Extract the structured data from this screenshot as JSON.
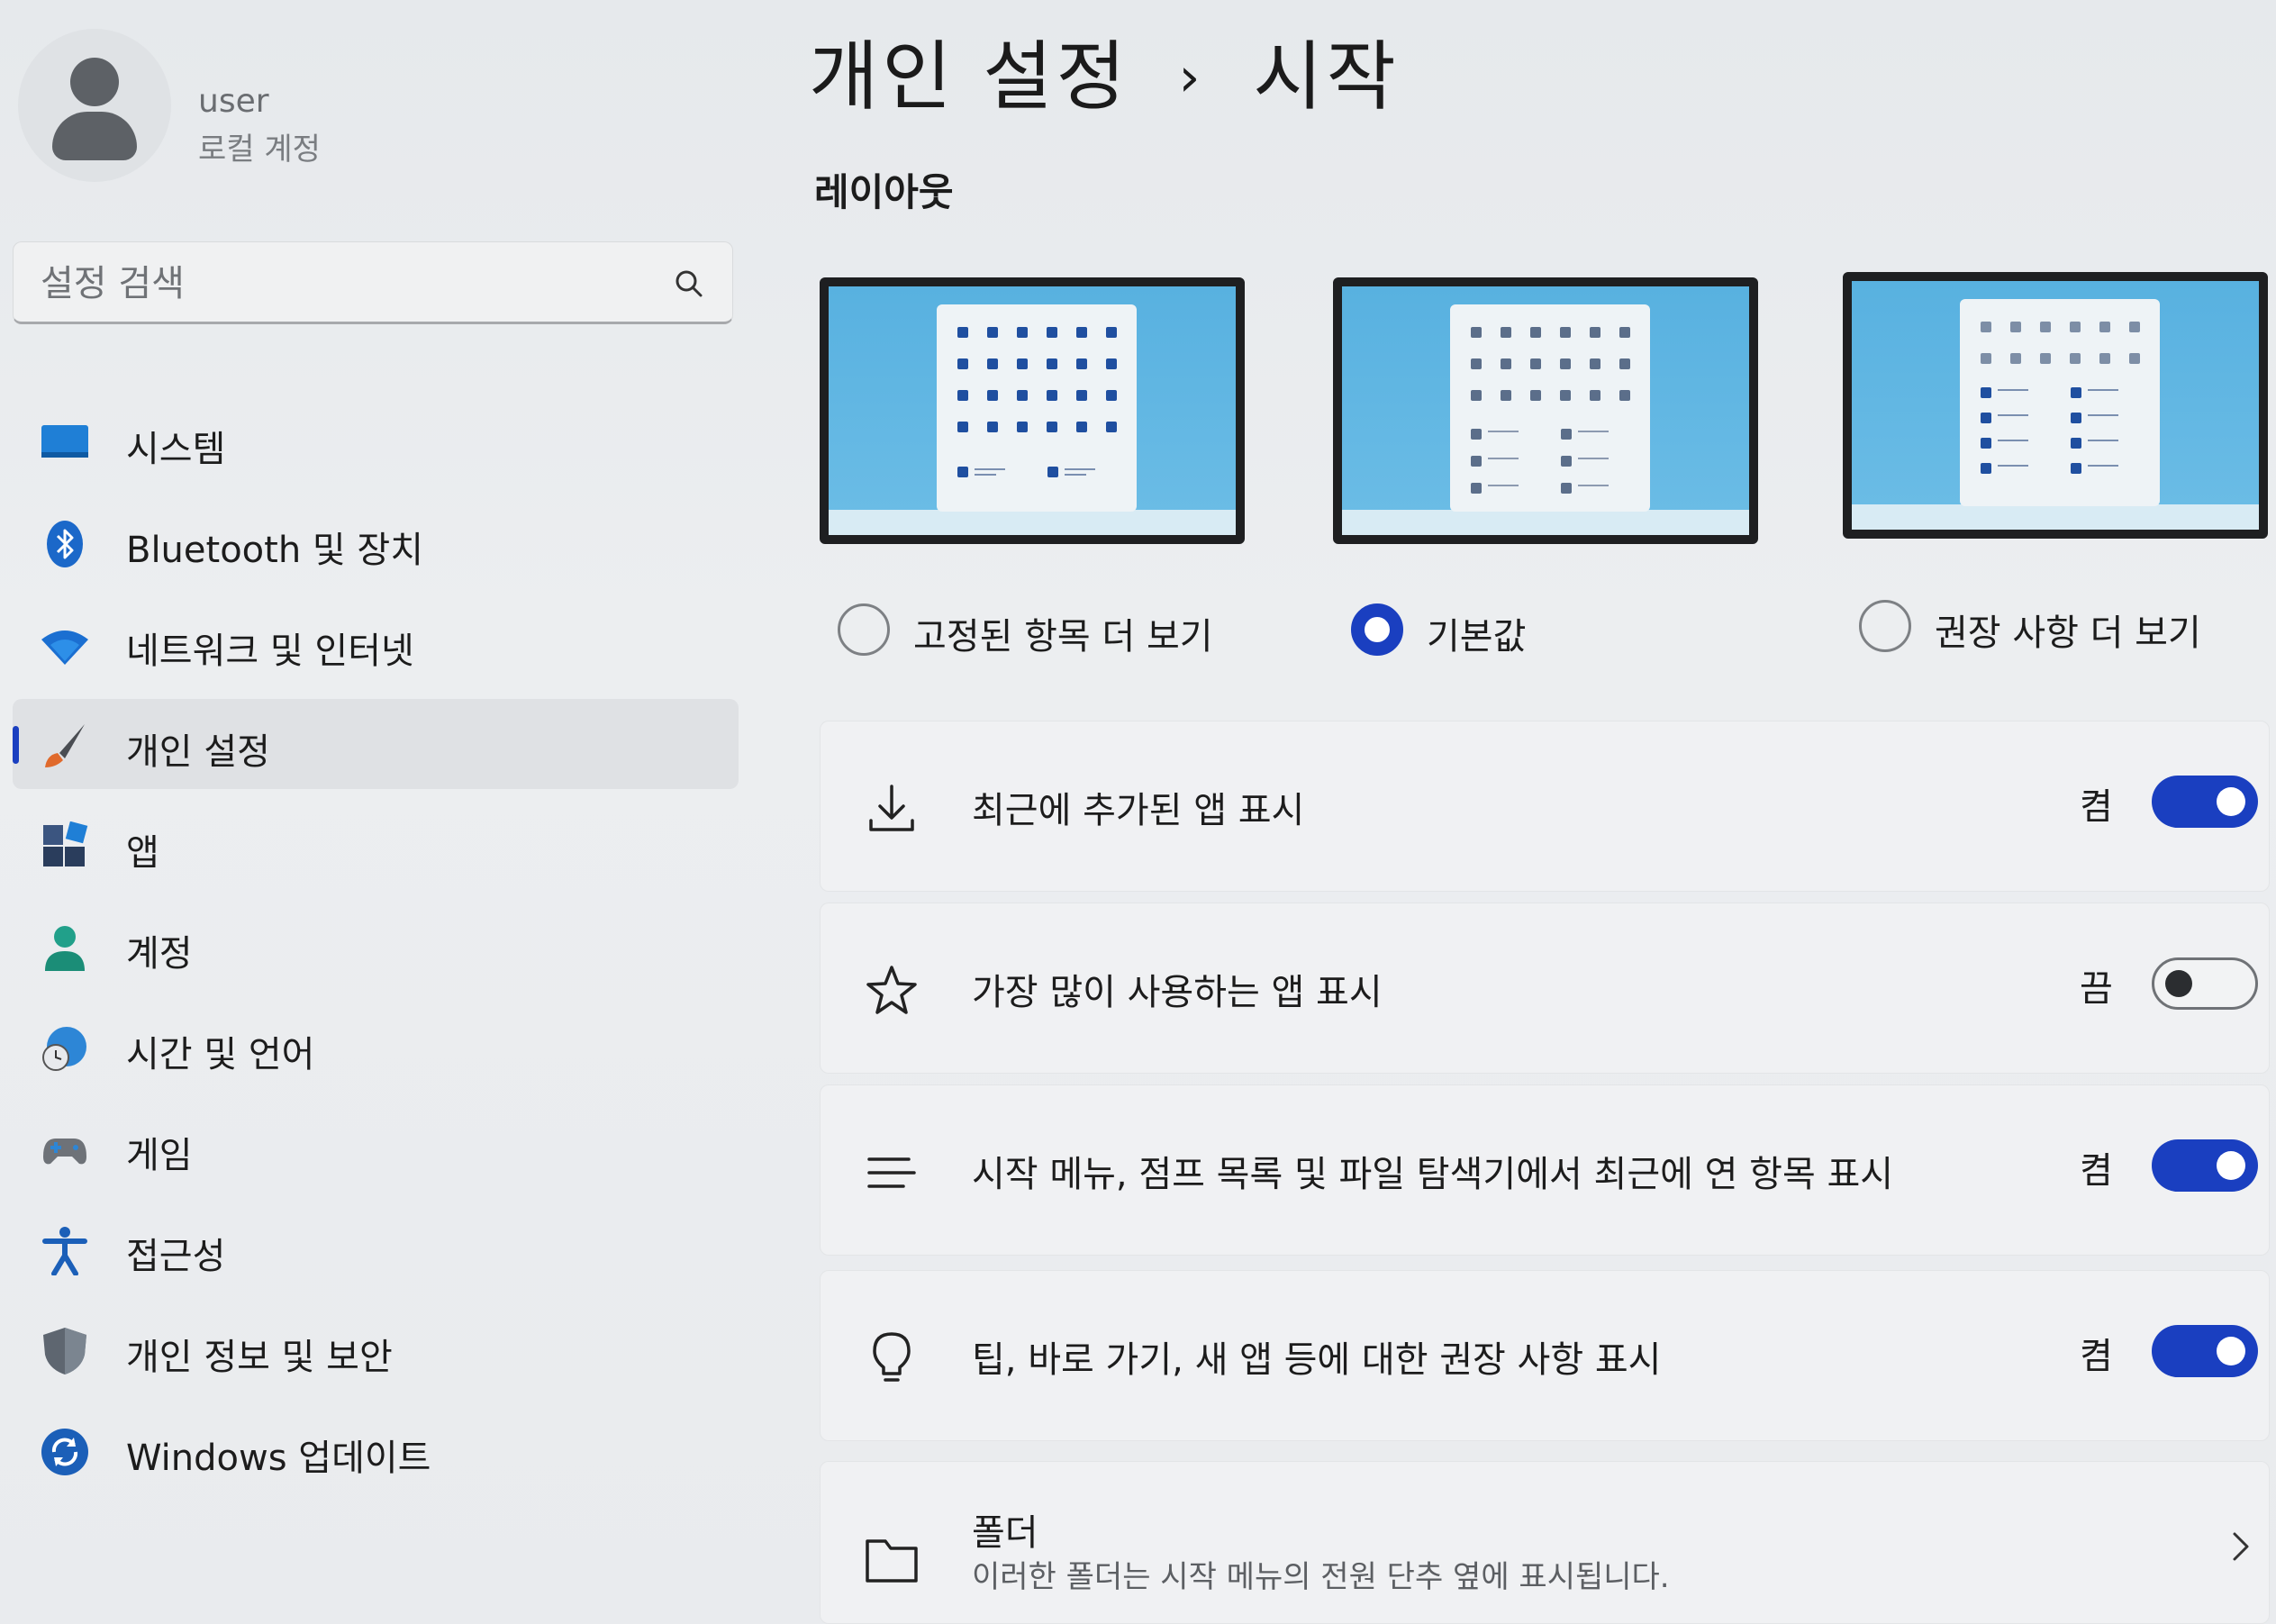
{
  "user": {
    "name": "user",
    "account_type": "로컬 계정"
  },
  "search": {
    "placeholder": "설정 검색"
  },
  "sidebar": {
    "items": [
      {
        "label": "시스템",
        "icon": "system-icon"
      },
      {
        "label": "Bluetooth 및 장치",
        "icon": "bluetooth-icon"
      },
      {
        "label": "네트워크 및 인터넷",
        "icon": "wifi-icon"
      },
      {
        "label": "개인 설정",
        "icon": "brush-icon",
        "selected": true
      },
      {
        "label": "앱",
        "icon": "apps-icon"
      },
      {
        "label": "계정",
        "icon": "account-icon"
      },
      {
        "label": "시간 및 언어",
        "icon": "globe-clock-icon"
      },
      {
        "label": "게임",
        "icon": "gamepad-icon"
      },
      {
        "label": "접근성",
        "icon": "accessibility-icon"
      },
      {
        "label": "개인 정보 및 보안",
        "icon": "shield-icon"
      },
      {
        "label": "Windows 업데이트",
        "icon": "update-icon"
      }
    ]
  },
  "header": {
    "breadcrumb_parent": "개인 설정",
    "separator": "›",
    "current": "시작"
  },
  "layout": {
    "section_title": "레이아웃",
    "options": [
      {
        "label": "고정된 항목 더 보기",
        "checked": false
      },
      {
        "label": "기본값",
        "checked": true
      },
      {
        "label": "권장 사항 더 보기",
        "checked": false
      }
    ]
  },
  "settings": [
    {
      "label": "최근에 추가된 앱 표시",
      "icon": "download-icon",
      "state": "켬",
      "on": true
    },
    {
      "label": "가장 많이 사용하는 앱 표시",
      "icon": "star-icon",
      "state": "끔",
      "on": false
    },
    {
      "label": "시작 메뉴, 점프 목록 및 파일 탐색기에서 최근에 연 항목 표시",
      "icon": "list-icon",
      "state": "켬",
      "on": true
    },
    {
      "label": "팁, 바로 가기, 새 앱 등에 대한 권장 사항 표시",
      "icon": "lightbulb-icon",
      "state": "켬",
      "on": true
    }
  ],
  "folders": {
    "title": "폴더",
    "description": "이러한 폴더는 시작 메뉴의 전원 단추 옆에 표시됩니다."
  },
  "colors": {
    "accent": "#1a3fc0",
    "selected_bg": "#dfe1e4",
    "card_bg": "#f0f1f3"
  }
}
